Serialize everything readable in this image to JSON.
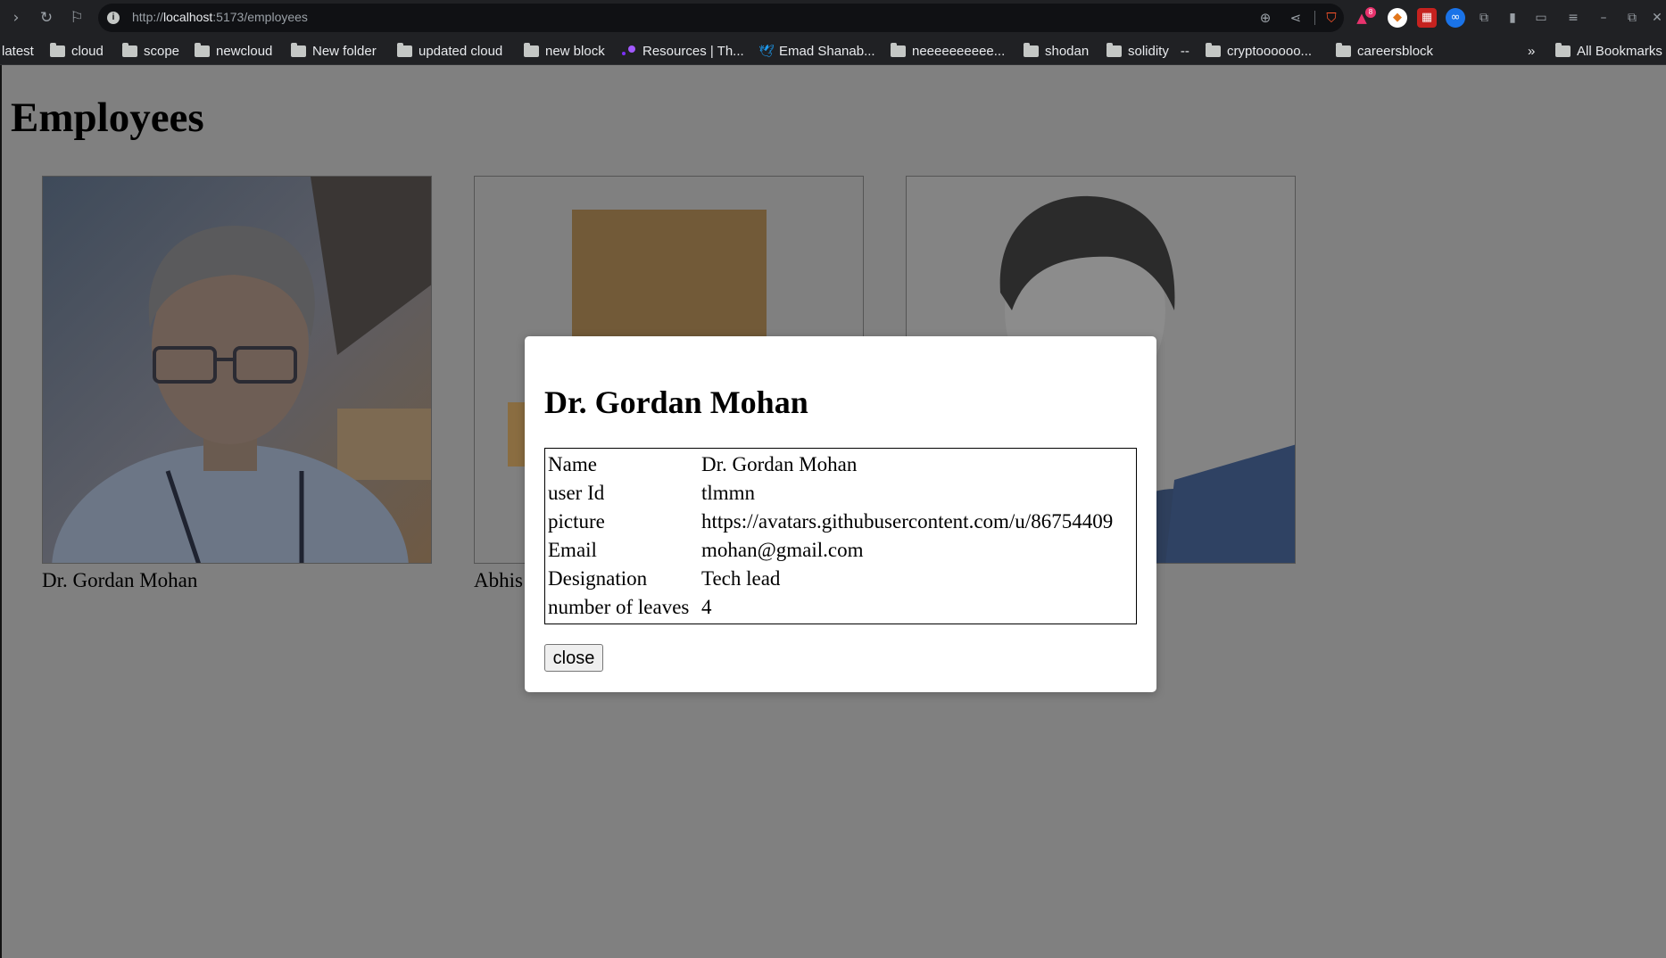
{
  "browser": {
    "url_scheme": "http://",
    "url_host": "localhost",
    "url_path": ":5173/employees",
    "bookmarks": [
      {
        "label": "latest",
        "icon": "none"
      },
      {
        "label": "cloud",
        "icon": "folder-icon"
      },
      {
        "label": "scope",
        "icon": "folder-icon"
      },
      {
        "label": "newcloud",
        "icon": "folder-icon"
      },
      {
        "label": "New folder",
        "icon": "folder-icon"
      },
      {
        "label": "updated cloud",
        "icon": "folder-icon"
      },
      {
        "label": "new block",
        "icon": "folder-icon"
      },
      {
        "label": "Resources | Th...",
        "icon": "resources-icon"
      },
      {
        "label": "Emad Shanab...",
        "icon": "bird-icon"
      },
      {
        "label": "neeeeeeeeee...",
        "icon": "folder-icon"
      },
      {
        "label": "shodan",
        "icon": "folder-icon"
      },
      {
        "label": "solidity",
        "icon": "folder-icon"
      },
      {
        "label": "cryptoooooo...",
        "icon": "folder-icon"
      },
      {
        "label": "careersblock",
        "icon": "folder-icon"
      }
    ],
    "solidity_separator": "--",
    "overflow_label": "»",
    "all_bookmarks_label": "All Bookmarks",
    "notification_count": "8"
  },
  "page": {
    "title": "Employees",
    "employees": [
      {
        "name": "Dr. Gordan Mohan"
      },
      {
        "name": "Abhis"
      },
      {
        "name": ""
      }
    ]
  },
  "modal": {
    "title": "Dr. Gordan Mohan",
    "rows": [
      {
        "label": "Name",
        "value": "Dr. Gordan Mohan"
      },
      {
        "label": "user Id",
        "value": "tlmmn"
      },
      {
        "label": "picture",
        "value": "https://avatars.githubusercontent.com/u/86754409"
      },
      {
        "label": "Email",
        "value": "mohan@gmail.com"
      },
      {
        "label": "Designation",
        "value": "Tech lead"
      },
      {
        "label": "number of leaves",
        "value": "4"
      }
    ],
    "close_label": "close"
  }
}
